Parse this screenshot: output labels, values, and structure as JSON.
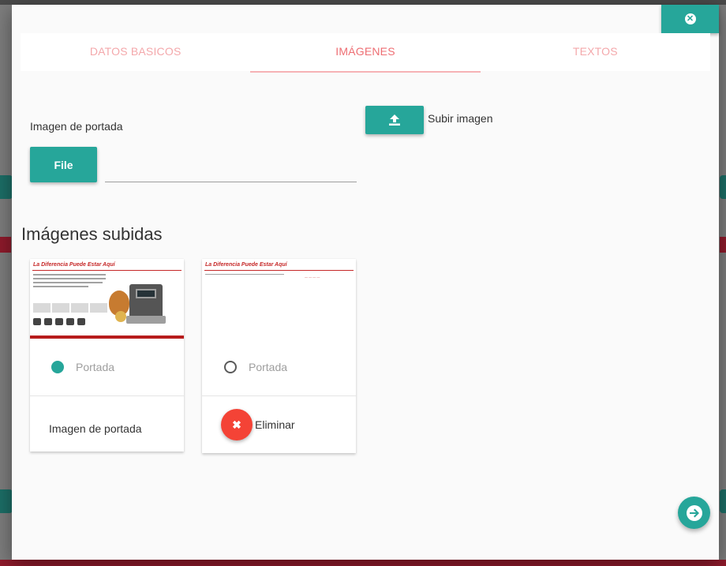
{
  "colors": {
    "accent": "#26a69a",
    "tab_text": "#ee6e73",
    "danger": "#f44336"
  },
  "close_button": {
    "icon": "close-circle-icon"
  },
  "tabs": [
    {
      "label": "DATOS BASICOS",
      "active": false
    },
    {
      "label": "IMÁGENES",
      "active": true
    },
    {
      "label": "TEXTOS",
      "active": false
    }
  ],
  "cover": {
    "label": "Imagen de portada",
    "file_button": "File",
    "file_path_value": ""
  },
  "upload": {
    "icon": "upload-icon",
    "label": "Subir imagen"
  },
  "uploaded": {
    "title": "Imágenes subidas",
    "cards": [
      {
        "thumb_title": "La Diferencia Puede Estar Aquí",
        "radio_label": "Portada",
        "radio_checked": true,
        "action_text": "Imagen de portada"
      },
      {
        "thumb_title": "La Diferencia Puede Estar Aquí",
        "radio_label": "Portada",
        "radio_checked": false,
        "action_text": "Eliminar",
        "action_icon": "delete-x-icon"
      }
    ]
  },
  "next_button": {
    "icon": "arrow-right-icon"
  }
}
